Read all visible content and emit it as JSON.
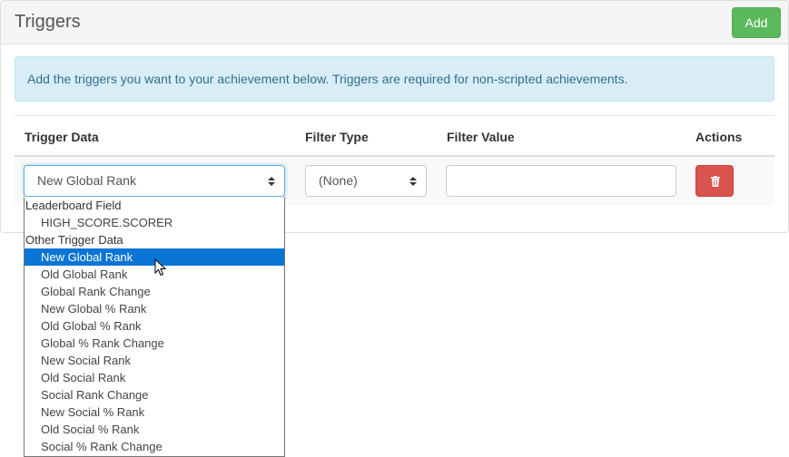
{
  "header": {
    "title": "Triggers",
    "add_label": "Add"
  },
  "alert": {
    "text": "Add the triggers you want to your achievement below. Triggers are required for non-scripted achievements."
  },
  "table": {
    "columns": [
      "Trigger Data",
      "Filter Type",
      "Filter Value",
      "Actions"
    ],
    "row": {
      "trigger_data": "New Global Rank",
      "filter_type": "(None)",
      "filter_value": "",
      "delete_icon": "trash-icon"
    }
  },
  "dropdown": {
    "groups": [
      {
        "label": "Leaderboard Field",
        "options": [
          "HIGH_SCORE.SCORER"
        ]
      },
      {
        "label": "Other Trigger Data",
        "options": [
          "New Global Rank",
          "Old Global Rank",
          "Global Rank Change",
          "New Global % Rank",
          "Old Global % Rank",
          "Global % Rank Change",
          "New Social Rank",
          "Old Social Rank",
          "Social Rank Change",
          "New Social % Rank",
          "Old Social % Rank",
          "Social % Rank Change"
        ]
      }
    ],
    "highlighted": "New Global Rank"
  },
  "colors": {
    "success": "#5cb85c",
    "danger": "#d9534f",
    "info_bg": "#d9edf7",
    "info_text": "#31708f",
    "highlight": "#0b75d5"
  }
}
